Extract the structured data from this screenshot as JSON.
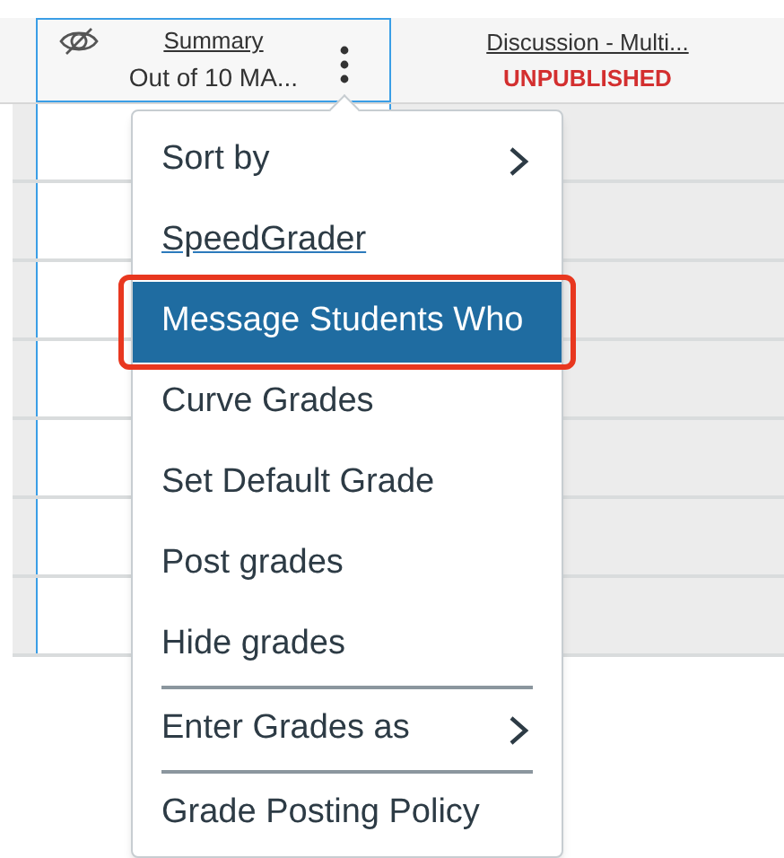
{
  "columns": [
    {
      "title": "Summary",
      "subtitle": "Out of 10 MA...",
      "muted_icon": true,
      "active": true
    },
    {
      "title": "Discussion - Multi...",
      "status": "UNPUBLISHED",
      "muted_icon": false,
      "active": false
    }
  ],
  "menu": {
    "items": [
      {
        "kind": "submenu",
        "label": "Sort by",
        "selected": false,
        "highlighted": false
      },
      {
        "kind": "link",
        "label": "SpeedGrader",
        "selected": false,
        "highlighted": false
      },
      {
        "kind": "item",
        "label": "Message Students Who",
        "selected": true,
        "highlighted": true
      },
      {
        "kind": "item",
        "label": "Curve Grades",
        "selected": false,
        "highlighted": false
      },
      {
        "kind": "item",
        "label": "Set Default Grade",
        "selected": false,
        "highlighted": false
      },
      {
        "kind": "item",
        "label": "Post grades",
        "selected": false,
        "highlighted": false
      },
      {
        "kind": "item",
        "label": "Hide grades",
        "selected": false,
        "highlighted": false
      },
      {
        "kind": "divider"
      },
      {
        "kind": "submenu",
        "label": "Enter Grades as",
        "selected": false,
        "highlighted": false
      },
      {
        "kind": "divider"
      },
      {
        "kind": "item",
        "label": "Grade Posting Policy",
        "selected": false,
        "highlighted": false
      }
    ]
  }
}
